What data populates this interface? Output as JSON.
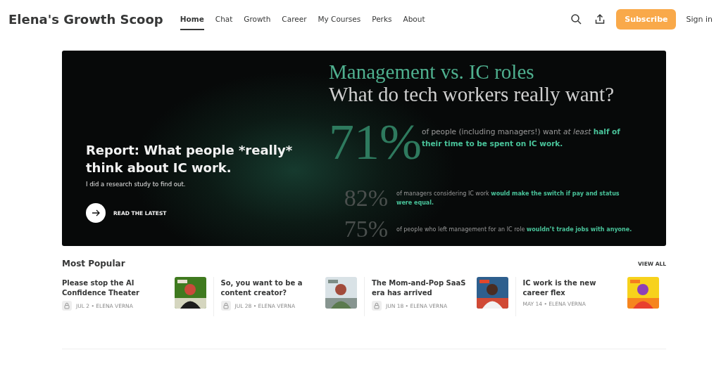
{
  "header": {
    "title": "Elena's Growth Scoop",
    "nav": [
      {
        "label": "Home",
        "selected": true
      },
      {
        "label": "Chat",
        "selected": false
      },
      {
        "label": "Growth",
        "selected": false
      },
      {
        "label": "Career",
        "selected": false
      },
      {
        "label": "My Courses",
        "selected": false
      },
      {
        "label": "Perks",
        "selected": false
      },
      {
        "label": "About",
        "selected": false
      }
    ],
    "subscribe": "Subscribe",
    "sign_in": "Sign in"
  },
  "hero": {
    "title": "Report: What people *really* think about IC work.",
    "subtitle": "I did a research study to find out.",
    "cta": "READ THE LATEST",
    "cover": {
      "heading_1": "Management vs. IC roles",
      "heading_2": "What do tech workers really want?",
      "stats": [
        {
          "figure": "71%",
          "kind": "large",
          "text": "of people (including managers!) want *at least* **half of their time to be spent on IC work.**"
        },
        {
          "figure": "82%",
          "kind": "small",
          "text": "of managers considering IC work **would make the switch if pay and status were equal.**"
        },
        {
          "figure": "75%",
          "kind": "small",
          "text": "of people who left management for an IC role **wouldn’t trade jobs with anyone.**"
        }
      ]
    }
  },
  "popular": {
    "title": "Most Popular",
    "view_all": "VIEW ALL",
    "posts": [
      {
        "title": "Please stop the AI Confidence Theater",
        "meta": "JUL 2 • ELENA VERNA",
        "locked": true
      },
      {
        "title": "So, you want to be a content creator?",
        "meta": "JUL 28 • ELENA VERNA",
        "locked": true
      },
      {
        "title": "The Mom-and-Pop SaaS era has arrived",
        "meta": "JUN 18 • ELENA VERNA",
        "locked": true
      },
      {
        "title": "IC work is the new career flex",
        "meta": "MAY 14 • ELENA VERNA",
        "locked": false
      }
    ]
  }
}
